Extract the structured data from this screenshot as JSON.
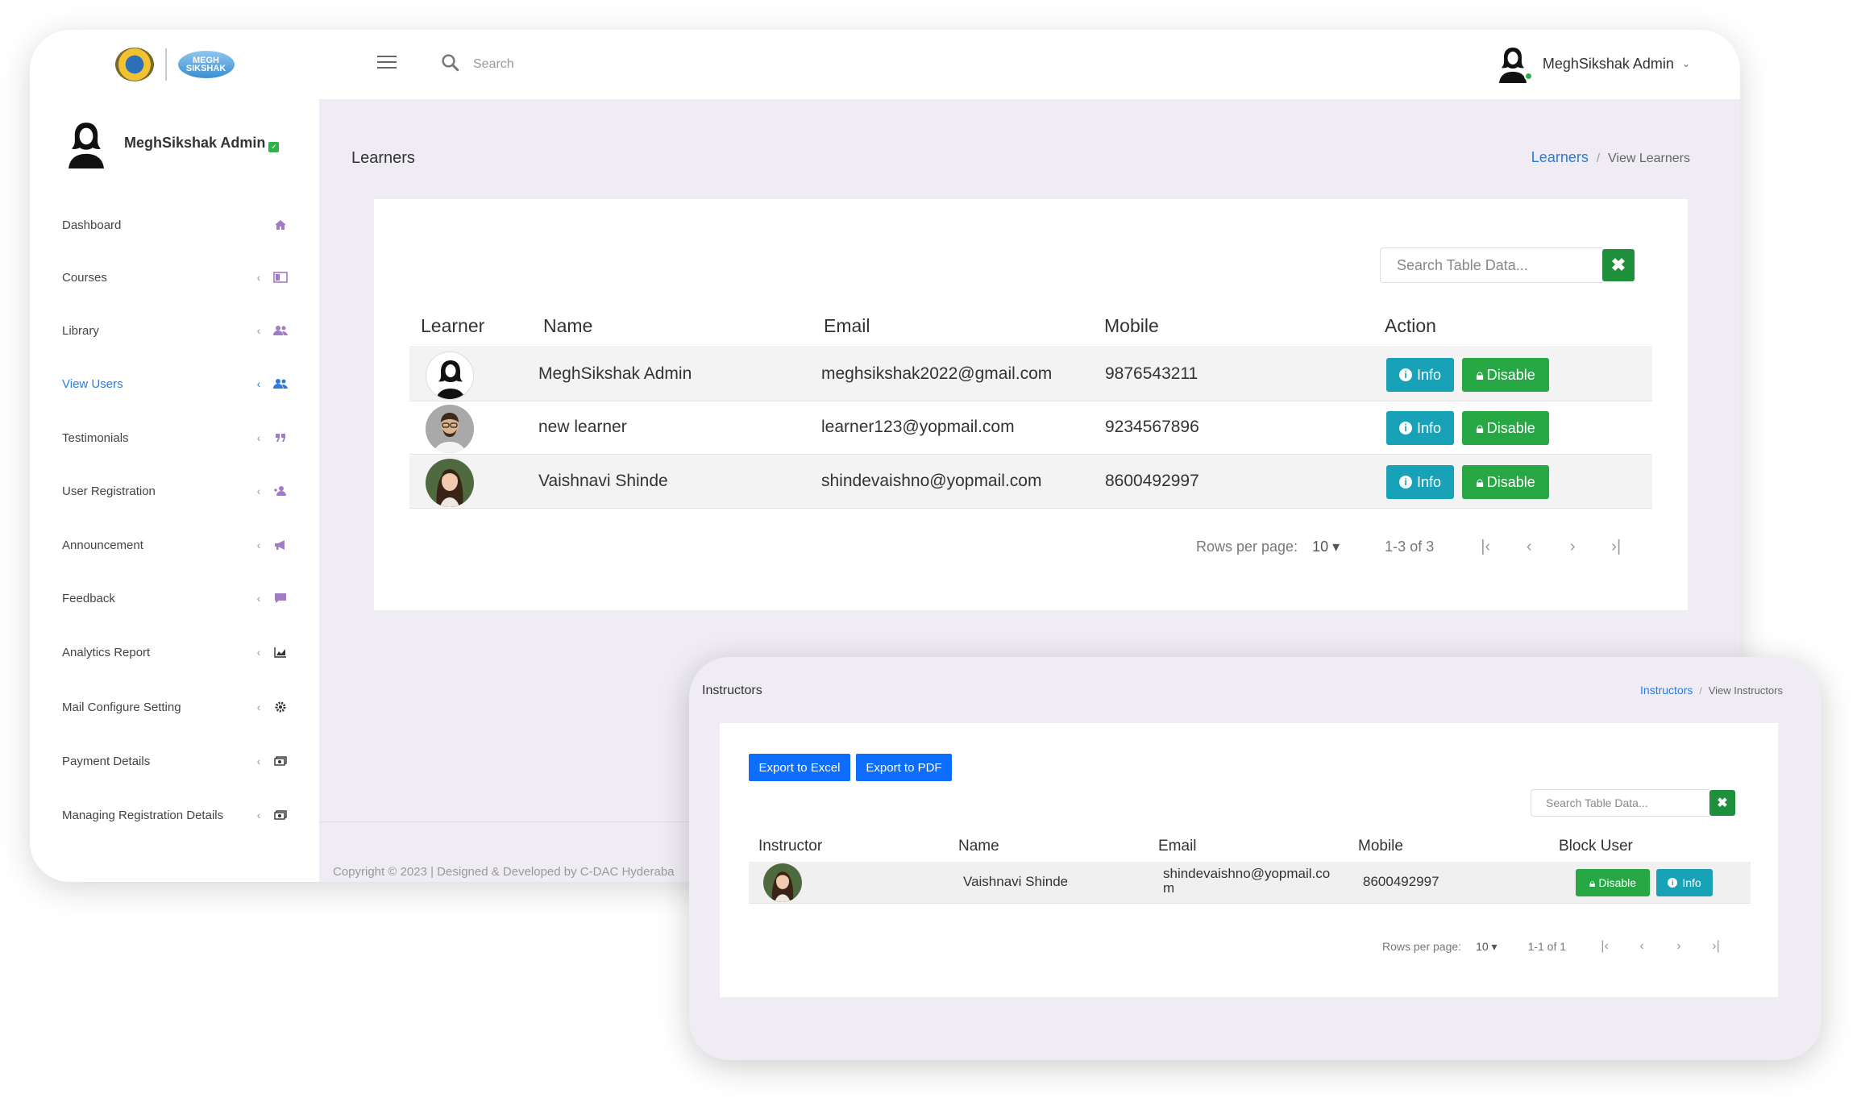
{
  "app": {
    "logo_text": "MEGH SIKSHAK"
  },
  "topbar": {
    "search_placeholder": "Search",
    "user_name": "MeghSikshak Admin",
    "caret": "⌄"
  },
  "sidebar": {
    "profile_name": "MeghSikshak Admin",
    "items": [
      {
        "label": "Dashboard",
        "icon": "home-icon",
        "chevron": ""
      },
      {
        "label": "Courses",
        "icon": "book-icon",
        "chevron": "‹"
      },
      {
        "label": "Library",
        "icon": "users-icon",
        "chevron": "‹"
      },
      {
        "label": "View Users",
        "icon": "users-icon",
        "chevron": "‹"
      },
      {
        "label": "Testimonials",
        "icon": "quote-icon",
        "chevron": "‹"
      },
      {
        "label": "User Registration",
        "icon": "user-add-icon",
        "chevron": "‹"
      },
      {
        "label": "Announcement",
        "icon": "megaphone-icon",
        "chevron": "‹"
      },
      {
        "label": "Feedback",
        "icon": "comment-icon",
        "chevron": "‹"
      },
      {
        "label": "Analytics Report",
        "icon": "chart-icon",
        "chevron": "‹"
      },
      {
        "label": "Mail Configure Setting",
        "icon": "gear-icon",
        "chevron": "‹"
      },
      {
        "label": "Payment Details",
        "icon": "money-icon",
        "chevron": "‹"
      },
      {
        "label": "Managing Registration Details",
        "icon": "money-icon",
        "chevron": "‹"
      }
    ],
    "active_color": "#2a7ae2"
  },
  "learners": {
    "page_title": "Learners",
    "breadcrumb": {
      "link": "Learners",
      "sep": "/",
      "current": "View Learners"
    },
    "search_placeholder": "Search Table Data...",
    "clear_label": "✖",
    "columns": [
      "Learner",
      "Name",
      "Email",
      "Mobile",
      "Action"
    ],
    "rows": [
      {
        "name": "MeghSikshak Admin",
        "email": "meghsikshak2022@gmail.com",
        "mobile": "9876543211"
      },
      {
        "name": "new learner",
        "email": "learner123@yopmail.com",
        "mobile": "9234567896"
      },
      {
        "name": "Vaishnavi Shinde",
        "email": "shindevaishno@yopmail.com",
        "mobile": "8600492997"
      }
    ],
    "info_label": "Info",
    "disable_label": "Disable",
    "pager": {
      "rows_label": "Rows per page:",
      "rows_value": "10",
      "range": "1-3 of 3"
    }
  },
  "footer": {
    "copyright": "Copyright © 2023 | Designed & Developed by C-DAC Hyderaba"
  },
  "instructors": {
    "page_title": "Instructors",
    "breadcrumb": {
      "link": "Instructors",
      "sep": "/",
      "current": "View Instructors"
    },
    "export_excel": "Export to Excel",
    "export_pdf": "Export to PDF",
    "search_placeholder": "Search Table Data...",
    "clear_label": "✖",
    "columns": [
      "Instructor",
      "Name",
      "Email",
      "Mobile",
      "Block User"
    ],
    "row": {
      "name": "Vaishnavi Shinde",
      "email": "shindevaishno@yopmail.co m",
      "mobile": "8600492997"
    },
    "disable_label": "Disable",
    "info_label": "Info",
    "pager": {
      "rows_label": "Rows per page:",
      "rows_value": "10",
      "range": "1-1 of 1"
    }
  },
  "colors": {
    "info": "#17a2b8",
    "success": "#28a745",
    "primary": "#0d6efd",
    "content_bg": "#efedf3",
    "link": "#2a7ae2"
  }
}
